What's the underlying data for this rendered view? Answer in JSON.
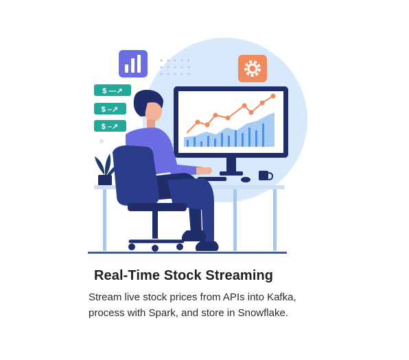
{
  "card": {
    "title": "Real-Time Stock Streaming",
    "description": "Stream live stock prices from APIs into Kafka, process with Spark, and store in Snowflake."
  },
  "illustration": {
    "money_tags": [
      "$ —↗",
      "$ –↗",
      "$ –↗"
    ],
    "icons": [
      "bar-chart-icon",
      "gear-icon",
      "plant-icon",
      "mug-icon"
    ],
    "colors": {
      "purple": "#6c6ce3",
      "orange": "#f08a5d",
      "teal": "#21a99a",
      "navy": "#1f2d6b",
      "light_blue": "#cfe6fb",
      "chart_blue": "#7ab2ee"
    }
  }
}
